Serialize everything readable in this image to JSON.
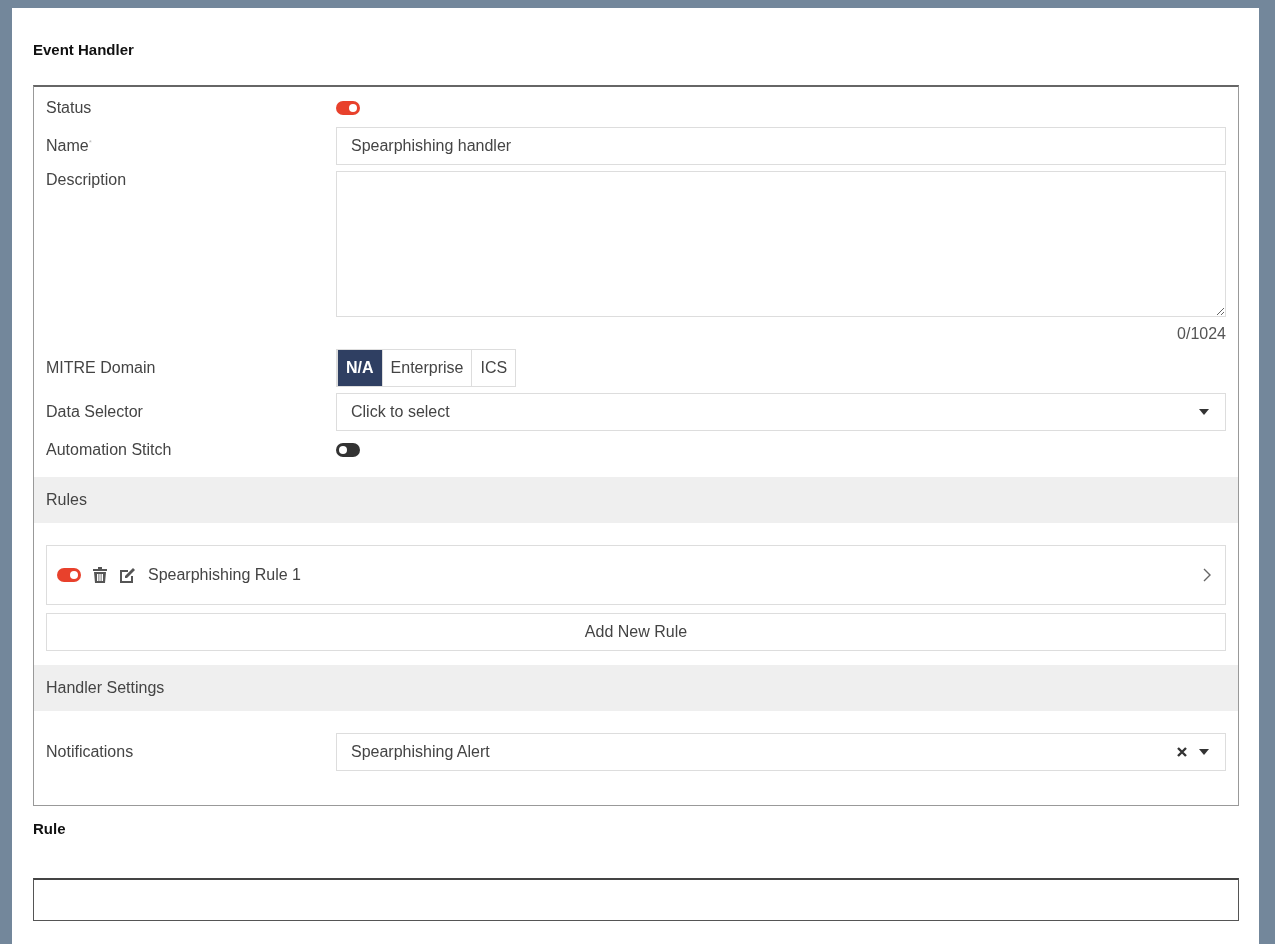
{
  "event_handler": {
    "title": "Event Handler",
    "status": {
      "label": "Status",
      "on": true
    },
    "name": {
      "label": "Name$^{*}$",
      "value": "Spearphishing handler"
    },
    "description": {
      "label": "Description",
      "counter": "0/1024"
    },
    "mitre_domain": {
      "label": "MITRE Domain",
      "options": [
        {
          "label": "N/A",
          "selected": true
        },
        {
          "label": "Enterprise",
          "selected": false
        },
        {
          "label": "ICS",
          "selected": false
        }
      ]
    },
    "data_selector": {
      "label": "Data Selector",
      "placeholder": "Click to select"
    },
    "automation_stitch": {
      "label": "Automation Stitch",
      "on": false
    },
    "rules": {
      "title": "Rules",
      "items": [
        {
          "name": "Spearphishing Rule 1",
          "on": true
        }
      ],
      "add_button": "Add New Rule"
    },
    "handler_settings": {
      "title": "Handler Settings",
      "notifications": {
        "label": "Notifications",
        "value": "Spearphishing Alert"
      }
    }
  },
  "rule": {
    "title": "Rule"
  }
}
